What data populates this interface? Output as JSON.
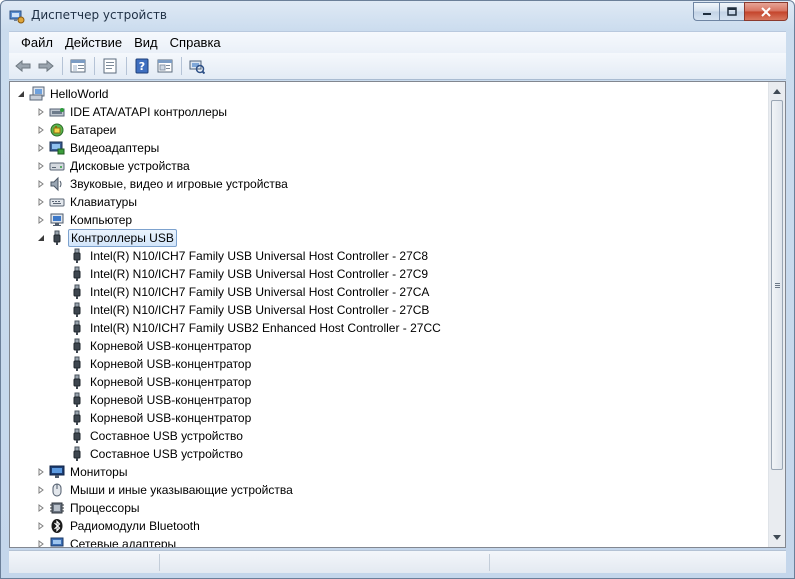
{
  "window": {
    "title": "Диспетчер устройств",
    "icon": "device-manager-icon"
  },
  "menu": [
    {
      "label": "Файл"
    },
    {
      "label": "Действие"
    },
    {
      "label": "Вид"
    },
    {
      "label": "Справка"
    }
  ],
  "toolbar": {
    "buttons": [
      "back-icon",
      "forward-icon",
      "show-hide-tree-icon",
      "properties-icon",
      "help-icon",
      "view-icon",
      "scan-hardware-icon"
    ]
  },
  "tree": {
    "root": {
      "label": "HelloWorld",
      "icon": "computer-icon",
      "expanded": true
    },
    "categories_before": [
      {
        "label": "IDE ATA/ATAPI контроллеры",
        "icon": "ide-controller-icon"
      },
      {
        "label": "Батареи",
        "icon": "battery-icon"
      },
      {
        "label": "Видеоадаптеры",
        "icon": "display-adapter-icon"
      },
      {
        "label": "Дисковые устройства",
        "icon": "disk-drive-icon"
      },
      {
        "label": "Звуковые, видео и игровые устройства",
        "icon": "speaker-icon"
      },
      {
        "label": "Клавиатуры",
        "icon": "keyboard-icon"
      },
      {
        "label": "Компьютер",
        "icon": "monitor-computer-icon"
      }
    ],
    "usb_category": {
      "label": "Контроллеры USB",
      "icon": "usb-plug-icon",
      "expanded": true,
      "selected": true
    },
    "usb_devices": [
      {
        "label": "Intel(R) N10/ICH7 Family USB Universal Host Controller - 27C8"
      },
      {
        "label": "Intel(R) N10/ICH7 Family USB Universal Host Controller - 27C9"
      },
      {
        "label": "Intel(R) N10/ICH7 Family USB Universal Host Controller - 27CA"
      },
      {
        "label": "Intel(R) N10/ICH7 Family USB Universal Host Controller - 27CB"
      },
      {
        "label": "Intel(R) N10/ICH7 Family USB2 Enhanced Host Controller - 27CC"
      },
      {
        "label": "Корневой USB-концентратор"
      },
      {
        "label": "Корневой USB-концентратор"
      },
      {
        "label": "Корневой USB-концентратор"
      },
      {
        "label": "Корневой USB-концентратор"
      },
      {
        "label": "Корневой USB-концентратор"
      },
      {
        "label": "Составное USB устройство"
      },
      {
        "label": "Составное USB устройство"
      }
    ],
    "categories_after": [
      {
        "label": "Мониторы",
        "icon": "monitor-icon"
      },
      {
        "label": "Мыши и иные указывающие устройства",
        "icon": "mouse-icon"
      },
      {
        "label": "Процессоры",
        "icon": "processor-icon"
      },
      {
        "label": "Радиомодули Bluetooth",
        "icon": "bluetooth-icon"
      },
      {
        "label": "Сетевые адаптеры",
        "icon": "network-adapter-icon"
      }
    ]
  },
  "colors": {
    "selection_border": "#7da2ce",
    "selection_fill": "#d2e5fa",
    "window_chrome": "#c4d6eb"
  }
}
